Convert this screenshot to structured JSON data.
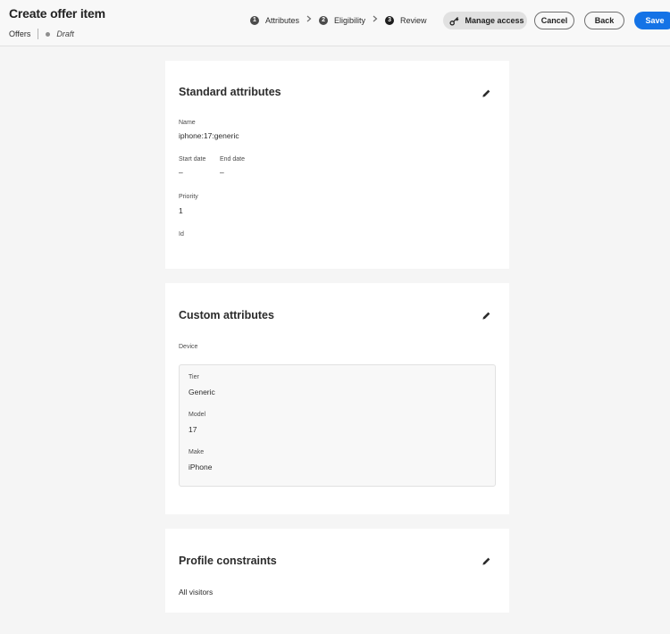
{
  "header": {
    "title": "Create offer item",
    "breadcrumb": "Offers",
    "status": "Draft"
  },
  "steps": [
    {
      "number": "1",
      "label": "Attributes"
    },
    {
      "number": "2",
      "label": "Eligibility"
    },
    {
      "number": "3",
      "label": "Review"
    }
  ],
  "actions": {
    "manage_access": "Manage access",
    "cancel": "Cancel",
    "back": "Back",
    "save": "Save"
  },
  "standard": {
    "title": "Standard attributes",
    "name_label": "Name",
    "name_value": "iphone:17:generic",
    "start_label": "Start date",
    "start_value": "–",
    "end_label": "End date",
    "end_value": "–",
    "priority_label": "Priority",
    "priority_value": "1",
    "id_label": "Id"
  },
  "custom": {
    "title": "Custom attributes",
    "device_label": "Device",
    "tier_label": "Tier",
    "tier_value": "Generic",
    "model_label": "Model",
    "model_value": "17",
    "make_label": "Make",
    "make_value": "iPhone"
  },
  "profile": {
    "title": "Profile constraints",
    "value": "All visitors"
  },
  "colors": {
    "accent": "#1473e6",
    "background": "#f5f5f5"
  },
  "icons": {
    "edit": "pencil-icon",
    "manage": "key-icon"
  }
}
